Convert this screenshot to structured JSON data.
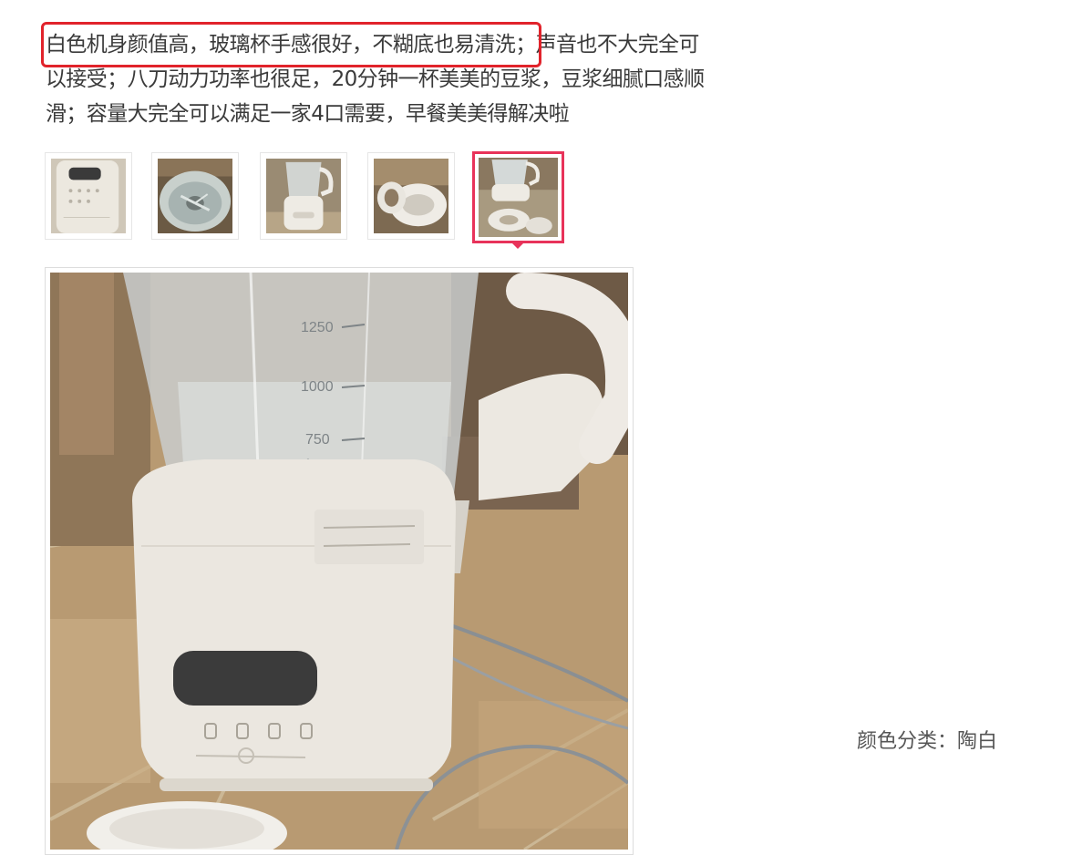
{
  "review": {
    "highlighted": "白色机身颜值高，玻璃杯手感很好，不糊底也易清洗；",
    "line1_rest": "声音也不大完全可",
    "line2": "以接受；八刀动力功率也很足，20分钟一杯美美的豆浆，豆浆细腻口感顺",
    "line3": "滑；容量大完全可以满足一家4口需要，早餐美美得解决啦"
  },
  "thumbnails": [
    {
      "name": "thumb-blender-front"
    },
    {
      "name": "thumb-glass-jar-top"
    },
    {
      "name": "thumb-blender-jar"
    },
    {
      "name": "thumb-blender-parts"
    },
    {
      "name": "thumb-blender-accessories",
      "selected": true
    }
  ],
  "main_image": {
    "jar_markings": [
      "1250",
      "1000",
      "750"
    ]
  },
  "attribute": {
    "label": "颜色分类：",
    "value": "陶白"
  },
  "colors": {
    "highlight_border": "#e1232b",
    "selected_thumb_border": "#e8335a"
  }
}
